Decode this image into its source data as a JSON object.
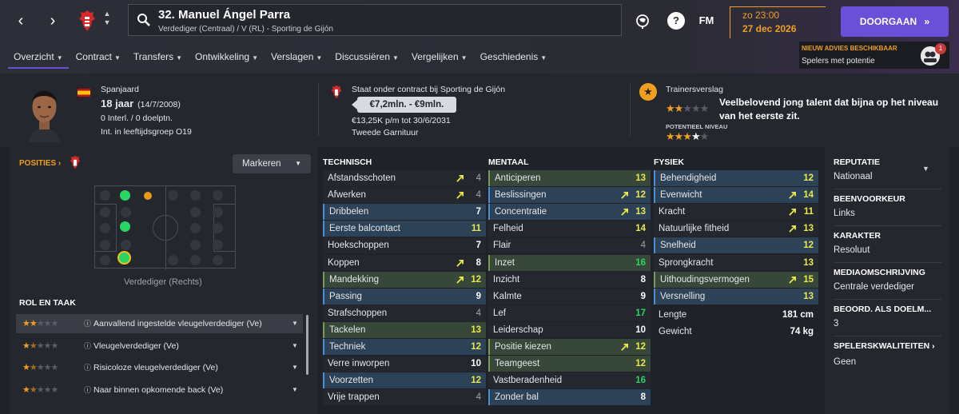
{
  "header": {
    "player_title": "32. Manuel Ángel Parra",
    "player_subtitle": "Verdediger (Centraal) / V (RL) - Sporting de Gijón",
    "fm_label": "FM",
    "help_label": "?",
    "date_time": "zo 23:00",
    "date_day": "27 dec 2026",
    "continue_label": "DOORGAAN",
    "advice_title": "NIEUW ADVIES BESCHIKBAAR",
    "advice_text": "Spelers met potentie",
    "advice_count": "1"
  },
  "tabs": [
    {
      "label": "Overzicht"
    },
    {
      "label": "Contract"
    },
    {
      "label": "Transfers"
    },
    {
      "label": "Ontwikkeling"
    },
    {
      "label": "Verslagen"
    },
    {
      "label": "Discussiëren"
    },
    {
      "label": "Vergelijken"
    },
    {
      "label": "Geschiedenis"
    }
  ],
  "profile": {
    "nationality": "Spanjaard",
    "age": "18 jaar",
    "birth_date": "(14/7/2008)",
    "caps": "0 Interl. / 0 doelptn.",
    "youth": "Int. in leeftijdsgroep O19"
  },
  "contract": {
    "title": "Staat onder contract bij Sporting de Gijón",
    "value": "€7,2mln. - €9mln.",
    "wage": "€13,25K p/m tot 30/6/2031",
    "squad_status": "Tweede Garnituur"
  },
  "report": {
    "title": "Trainersverslag",
    "text": "Veelbelovend jong talent dat bijna op het niveau van het eerste zit.",
    "potential_label": "POTENTIEEL NIVEAU",
    "current_stars": 2,
    "potential_stars": 3.5
  },
  "positions": {
    "link": "POSITIES",
    "markeren": "Markeren",
    "caption": "Verdediger (Rechts)"
  },
  "roles": {
    "title": "ROL EN TAAK",
    "items": [
      {
        "label": "Aanvallend ingestelde vleugelverdediger (Ve)",
        "stars": 2
      },
      {
        "label": "Vleugelverdediger (Ve)",
        "stars": 1.5
      },
      {
        "label": "Risicoloze vleugelverdediger (Ve)",
        "stars": 1.5
      },
      {
        "label": "Naar binnen opkomende back (Ve)",
        "stars": 1.5
      }
    ]
  },
  "technical": {
    "title": "TECHNISCH",
    "rows": [
      {
        "name": "Afstandsschoten",
        "value": "4",
        "hl": "plain",
        "arrow": true,
        "color": "dim"
      },
      {
        "name": "Afwerken",
        "value": "4",
        "hl": "plain",
        "arrow": true,
        "color": "dim"
      },
      {
        "name": "Dribbelen",
        "value": "7",
        "hl": "blue",
        "arrow": false,
        "color": "white"
      },
      {
        "name": "Eerste balcontact",
        "value": "11",
        "hl": "blue",
        "arrow": false,
        "color": "yellow"
      },
      {
        "name": "Hoekschoppen",
        "value": "7",
        "hl": "plain",
        "arrow": false,
        "color": "white"
      },
      {
        "name": "Koppen",
        "value": "8",
        "hl": "plain",
        "arrow": true,
        "color": "white"
      },
      {
        "name": "Mandekking",
        "value": "12",
        "hl": "green",
        "arrow": true,
        "color": "yellow"
      },
      {
        "name": "Passing",
        "value": "9",
        "hl": "blue",
        "arrow": false,
        "color": "white"
      },
      {
        "name": "Strafschoppen",
        "value": "4",
        "hl": "plain",
        "arrow": false,
        "color": "dim"
      },
      {
        "name": "Tackelen",
        "value": "13",
        "hl": "green",
        "arrow": false,
        "color": "yellow"
      },
      {
        "name": "Techniek",
        "value": "12",
        "hl": "blue",
        "arrow": false,
        "color": "yellow"
      },
      {
        "name": "Verre inworpen",
        "value": "10",
        "hl": "plain",
        "arrow": false,
        "color": "white"
      },
      {
        "name": "Voorzetten",
        "value": "12",
        "hl": "blue",
        "arrow": false,
        "color": "yellow"
      },
      {
        "name": "Vrije trappen",
        "value": "4",
        "hl": "plain",
        "arrow": false,
        "color": "dim"
      }
    ]
  },
  "mental": {
    "title": "MENTAAL",
    "rows": [
      {
        "name": "Anticiperen",
        "value": "13",
        "hl": "green",
        "arrow": false,
        "color": "yellow"
      },
      {
        "name": "Beslissingen",
        "value": "12",
        "hl": "blue",
        "arrow": true,
        "color": "yellow"
      },
      {
        "name": "Concentratie",
        "value": "13",
        "hl": "blue",
        "arrow": true,
        "color": "yellow"
      },
      {
        "name": "Felheid",
        "value": "14",
        "hl": "plain",
        "arrow": false,
        "color": "yellow"
      },
      {
        "name": "Flair",
        "value": "4",
        "hl": "plain",
        "arrow": false,
        "color": "dim"
      },
      {
        "name": "Inzet",
        "value": "16",
        "hl": "green",
        "arrow": false,
        "color": "green"
      },
      {
        "name": "Inzicht",
        "value": "8",
        "hl": "plain",
        "arrow": false,
        "color": "white"
      },
      {
        "name": "Kalmte",
        "value": "9",
        "hl": "plain",
        "arrow": false,
        "color": "white"
      },
      {
        "name": "Lef",
        "value": "17",
        "hl": "plain",
        "arrow": false,
        "color": "green"
      },
      {
        "name": "Leiderschap",
        "value": "10",
        "hl": "plain",
        "arrow": false,
        "color": "white"
      },
      {
        "name": "Positie kiezen",
        "value": "12",
        "hl": "green",
        "arrow": true,
        "color": "yellow"
      },
      {
        "name": "Teamgeest",
        "value": "12",
        "hl": "green",
        "arrow": false,
        "color": "yellow"
      },
      {
        "name": "Vastberadenheid",
        "value": "16",
        "hl": "plain",
        "arrow": false,
        "color": "green"
      },
      {
        "name": "Zonder bal",
        "value": "8",
        "hl": "blue",
        "arrow": false,
        "color": "white"
      }
    ]
  },
  "physical": {
    "title": "FYSIEK",
    "rows": [
      {
        "name": "Behendigheid",
        "value": "12",
        "hl": "blue",
        "arrow": false,
        "color": "yellow"
      },
      {
        "name": "Evenwicht",
        "value": "14",
        "hl": "blue",
        "arrow": true,
        "color": "yellow"
      },
      {
        "name": "Kracht",
        "value": "11",
        "hl": "plain",
        "arrow": true,
        "color": "yellow"
      },
      {
        "name": "Natuurlijke fitheid",
        "value": "13",
        "hl": "plain",
        "arrow": true,
        "color": "yellow"
      },
      {
        "name": "Snelheid",
        "value": "12",
        "hl": "blue",
        "arrow": false,
        "color": "yellow"
      },
      {
        "name": "Sprongkracht",
        "value": "13",
        "hl": "plain",
        "arrow": false,
        "color": "yellow"
      },
      {
        "name": "Uithoudingsvermogen",
        "value": "15",
        "hl": "green",
        "arrow": true,
        "color": "yellow"
      },
      {
        "name": "Versnelling",
        "value": "13",
        "hl": "blue",
        "arrow": false,
        "color": "yellow"
      }
    ],
    "height_label": "Lengte",
    "height_value": "181 cm",
    "weight_label": "Gewicht",
    "weight_value": "74 kg"
  },
  "side": {
    "reputation_head": "REPUTATIE",
    "reputation_val": "Nationaal",
    "foot_head": "BEENVOORKEUR",
    "foot_val": "Links",
    "character_head": "KARAKTER",
    "character_val": "Resoluut",
    "media_head": "MEDIAOMSCHRIJVING",
    "media_val": "Centrale verdediger",
    "gk_head": "BEOORD. ALS DOELM...",
    "gk_val": "3",
    "traits_head": "SPELERSKWALITEITEN",
    "traits_val": "Geen"
  },
  "colors": {
    "accent": "#6a4fd8",
    "highlight": "#f0a020",
    "green": "#2bd463"
  }
}
